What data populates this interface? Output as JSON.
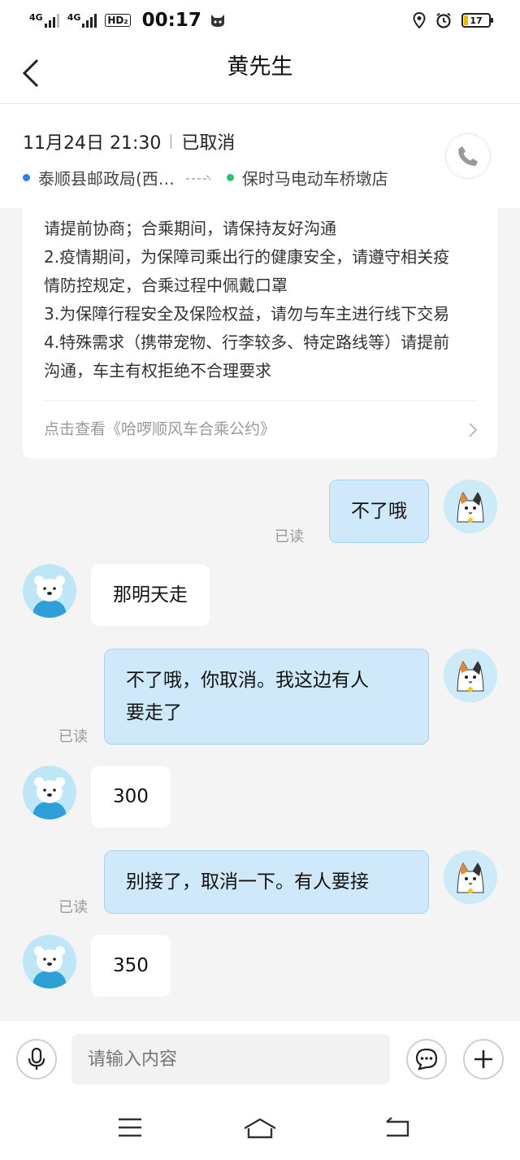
{
  "status_bar": {
    "signal1": "4G",
    "signal2": "4G",
    "hd": "HD₂",
    "time": "00:17",
    "battery": "17"
  },
  "header": {
    "title": "黄先生"
  },
  "trip": {
    "date_time": "11月24日 21:30",
    "status": "已取消",
    "from": "泰顺县邮政局(西…",
    "to": "保时马电动车桥墩店"
  },
  "notice": {
    "lines": [
      "请提前协商；合乘期间，请保持友好沟通",
      "2.疫情期间，为保障司乘出行的健康安全，请遵守相关疫",
      "情防控规定，合乘过程中佩戴口罩",
      "3.为保障行程安全及保险权益，请勿与车主进行线下交易",
      "4.特殊需求（携带宠物、行李较多、特定路线等）请提前",
      "沟通，车主有权拒绝不合理要求"
    ],
    "link": "点击查看《哈啰顺风车合乘公约》"
  },
  "messages": [
    {
      "from": "me",
      "lines": [
        "不了哦"
      ],
      "read": "已读"
    },
    {
      "from": "them",
      "lines": [
        "那明天走"
      ]
    },
    {
      "from": "me",
      "lines": [
        "不了哦，你取消。我这边有人",
        "要走了"
      ],
      "read": "已读"
    },
    {
      "from": "them",
      "lines": [
        "300"
      ]
    },
    {
      "from": "me",
      "lines": [
        "别接了，取消一下。有人要接"
      ],
      "read": "已读"
    },
    {
      "from": "them",
      "lines": [
        "350"
      ]
    }
  ],
  "input": {
    "placeholder": "请输入内容"
  },
  "colors": {
    "accent_blue": "#2f80ed",
    "accent_green": "#2ec36b",
    "my_bubble": "#cfe9fb",
    "avatar_bg": "#bfe6f7"
  }
}
